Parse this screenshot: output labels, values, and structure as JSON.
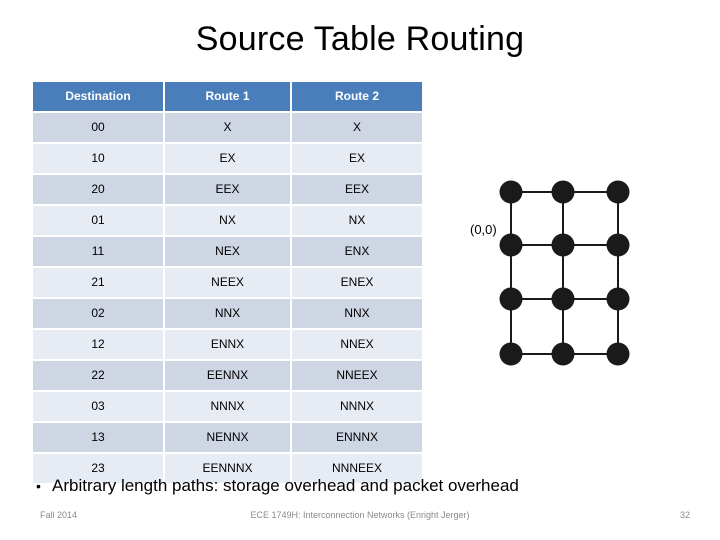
{
  "slide": {
    "title": "Source Table Routing"
  },
  "table": {
    "columns": [
      "Destination",
      "Route 1",
      "Route 2"
    ],
    "header_bg": "#4A7EBB",
    "row_bg_odd": "#CED5E3",
    "row_bg_even": "#E7EBF3",
    "rows": [
      {
        "destination": "00",
        "route1": "X",
        "route2": "X"
      },
      {
        "destination": "10",
        "route1": "EX",
        "route2": "EX"
      },
      {
        "destination": "20",
        "route1": "EEX",
        "route2": "EEX"
      },
      {
        "destination": "01",
        "route1": "NX",
        "route2": "NX"
      },
      {
        "destination": "11",
        "route1": "NEX",
        "route2": "ENX"
      },
      {
        "destination": "21",
        "route1": "NEEX",
        "route2": "ENEX"
      },
      {
        "destination": "02",
        "route1": "NNX",
        "route2": "NNX"
      },
      {
        "destination": "12",
        "route1": "ENNX",
        "route2": "NNEX"
      },
      {
        "destination": "22",
        "route1": "EENNX",
        "route2": "NNEEX"
      },
      {
        "destination": "03",
        "route1": "NNNX",
        "route2": "NNNX"
      },
      {
        "destination": "13",
        "route1": "NENNX",
        "route2": "ENNNX"
      },
      {
        "destination": "23",
        "route1": "EENNNX",
        "route2": "NNNEEX"
      }
    ]
  },
  "diagram": {
    "name": "mesh-network-diagram",
    "origin_label": "(0,0)",
    "node_color": "#1a1a1a",
    "link_color": "#1a1a1a",
    "columns": 3,
    "rows": 4
  },
  "bullets": [
    {
      "marker": "•",
      "text": "Arbitrary length paths: storage overhead and packet overhead"
    }
  ],
  "footer": {
    "left": "Fall 2014",
    "center": "ECE 1749H: Interconnection Networks (Enright Jerger)",
    "right": "32"
  }
}
